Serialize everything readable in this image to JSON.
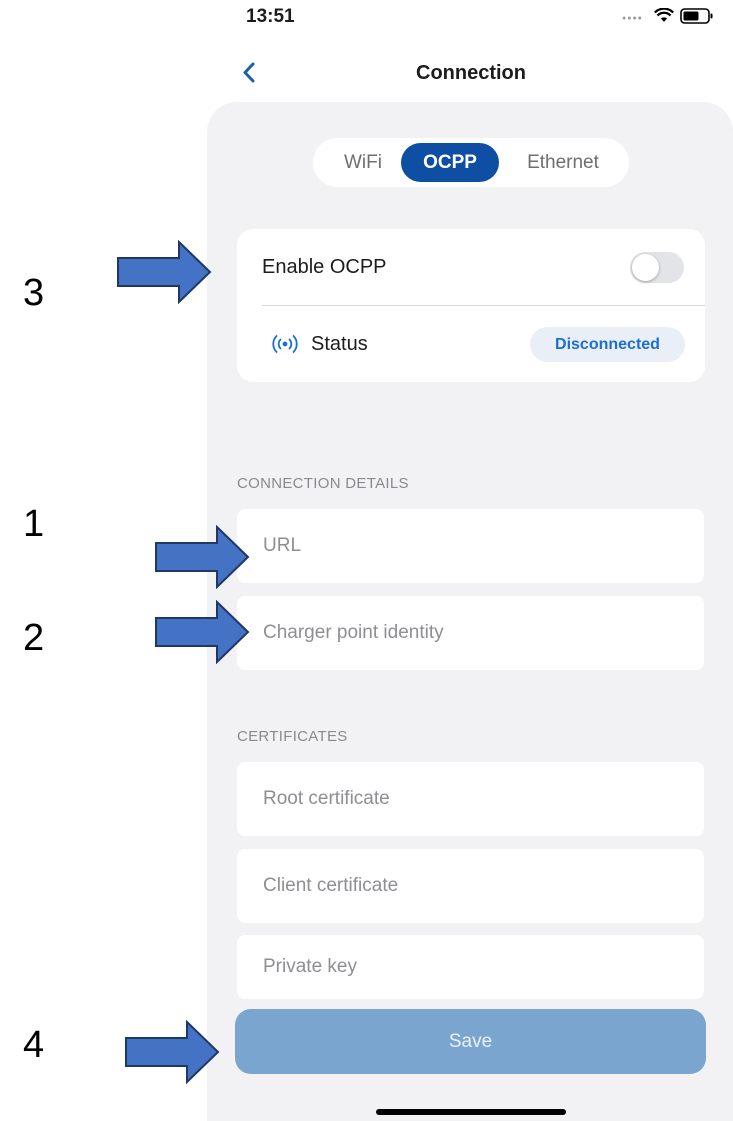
{
  "status_bar": {
    "time": "13:51"
  },
  "nav": {
    "title": "Connection"
  },
  "tabs": [
    {
      "label": "WiFi",
      "selected": false
    },
    {
      "label": "OCPP",
      "selected": true
    },
    {
      "label": "Ethernet",
      "selected": false
    }
  ],
  "ocpp_card": {
    "enable_label": "Enable OCPP",
    "enabled": false,
    "status_label": "Status",
    "status_value": "Disconnected"
  },
  "connection_details": {
    "title": "CONNECTION DETAILS",
    "url_placeholder": "URL",
    "identity_placeholder": "Charger point identity"
  },
  "certificates": {
    "title": "CERTIFICATES",
    "root_placeholder": "Root certificate",
    "client_placeholder": "Client certificate",
    "key_placeholder": "Private key"
  },
  "save_label": "Save",
  "annotations": [
    "3",
    "1",
    "2",
    "4"
  ],
  "colors": {
    "accent": "#0f4fa3",
    "status_text": "#1a6fd1",
    "save_disabled": "#7aa5cf",
    "arrow_fill": "#4472c4",
    "panel_bg": "#f2f2f4"
  }
}
